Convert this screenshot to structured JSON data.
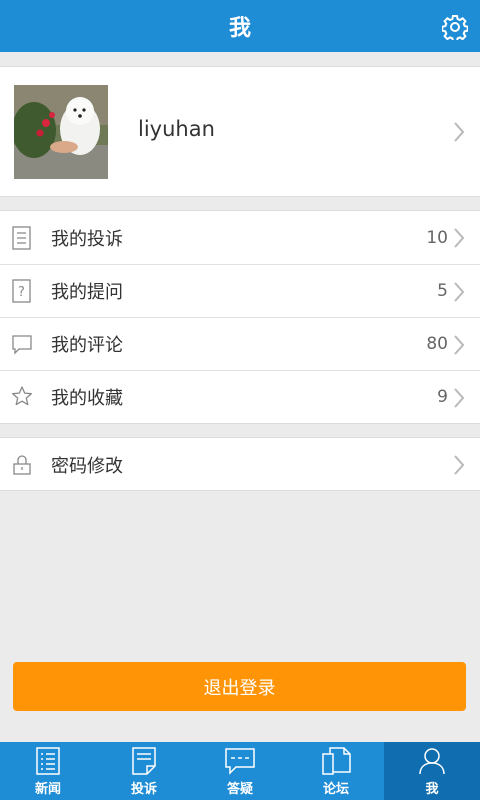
{
  "header": {
    "title": "我"
  },
  "profile": {
    "username": "liyuhan"
  },
  "menu": [
    {
      "label": "我的投诉",
      "count": "10",
      "icon": "document-icon"
    },
    {
      "label": "我的提问",
      "count": "5",
      "icon": "question-icon"
    },
    {
      "label": "我的评论",
      "count": "80",
      "icon": "comment-icon"
    },
    {
      "label": "我的收藏",
      "count": "9",
      "icon": "star-icon"
    }
  ],
  "security": {
    "label": "密码修改",
    "icon": "lock-icon"
  },
  "logout": {
    "label": "退出登录"
  },
  "tabs": [
    {
      "label": "新闻",
      "icon": "news-icon"
    },
    {
      "label": "投诉",
      "icon": "complaint-icon"
    },
    {
      "label": "答疑",
      "icon": "qa-icon"
    },
    {
      "label": "论坛",
      "icon": "forum-icon"
    },
    {
      "label": "我",
      "icon": "user-icon",
      "active": true
    }
  ],
  "colors": {
    "primary": "#1f8dd6",
    "active_tab": "#0f6db0",
    "logout": "#ff9406",
    "background": "#ebebeb"
  }
}
